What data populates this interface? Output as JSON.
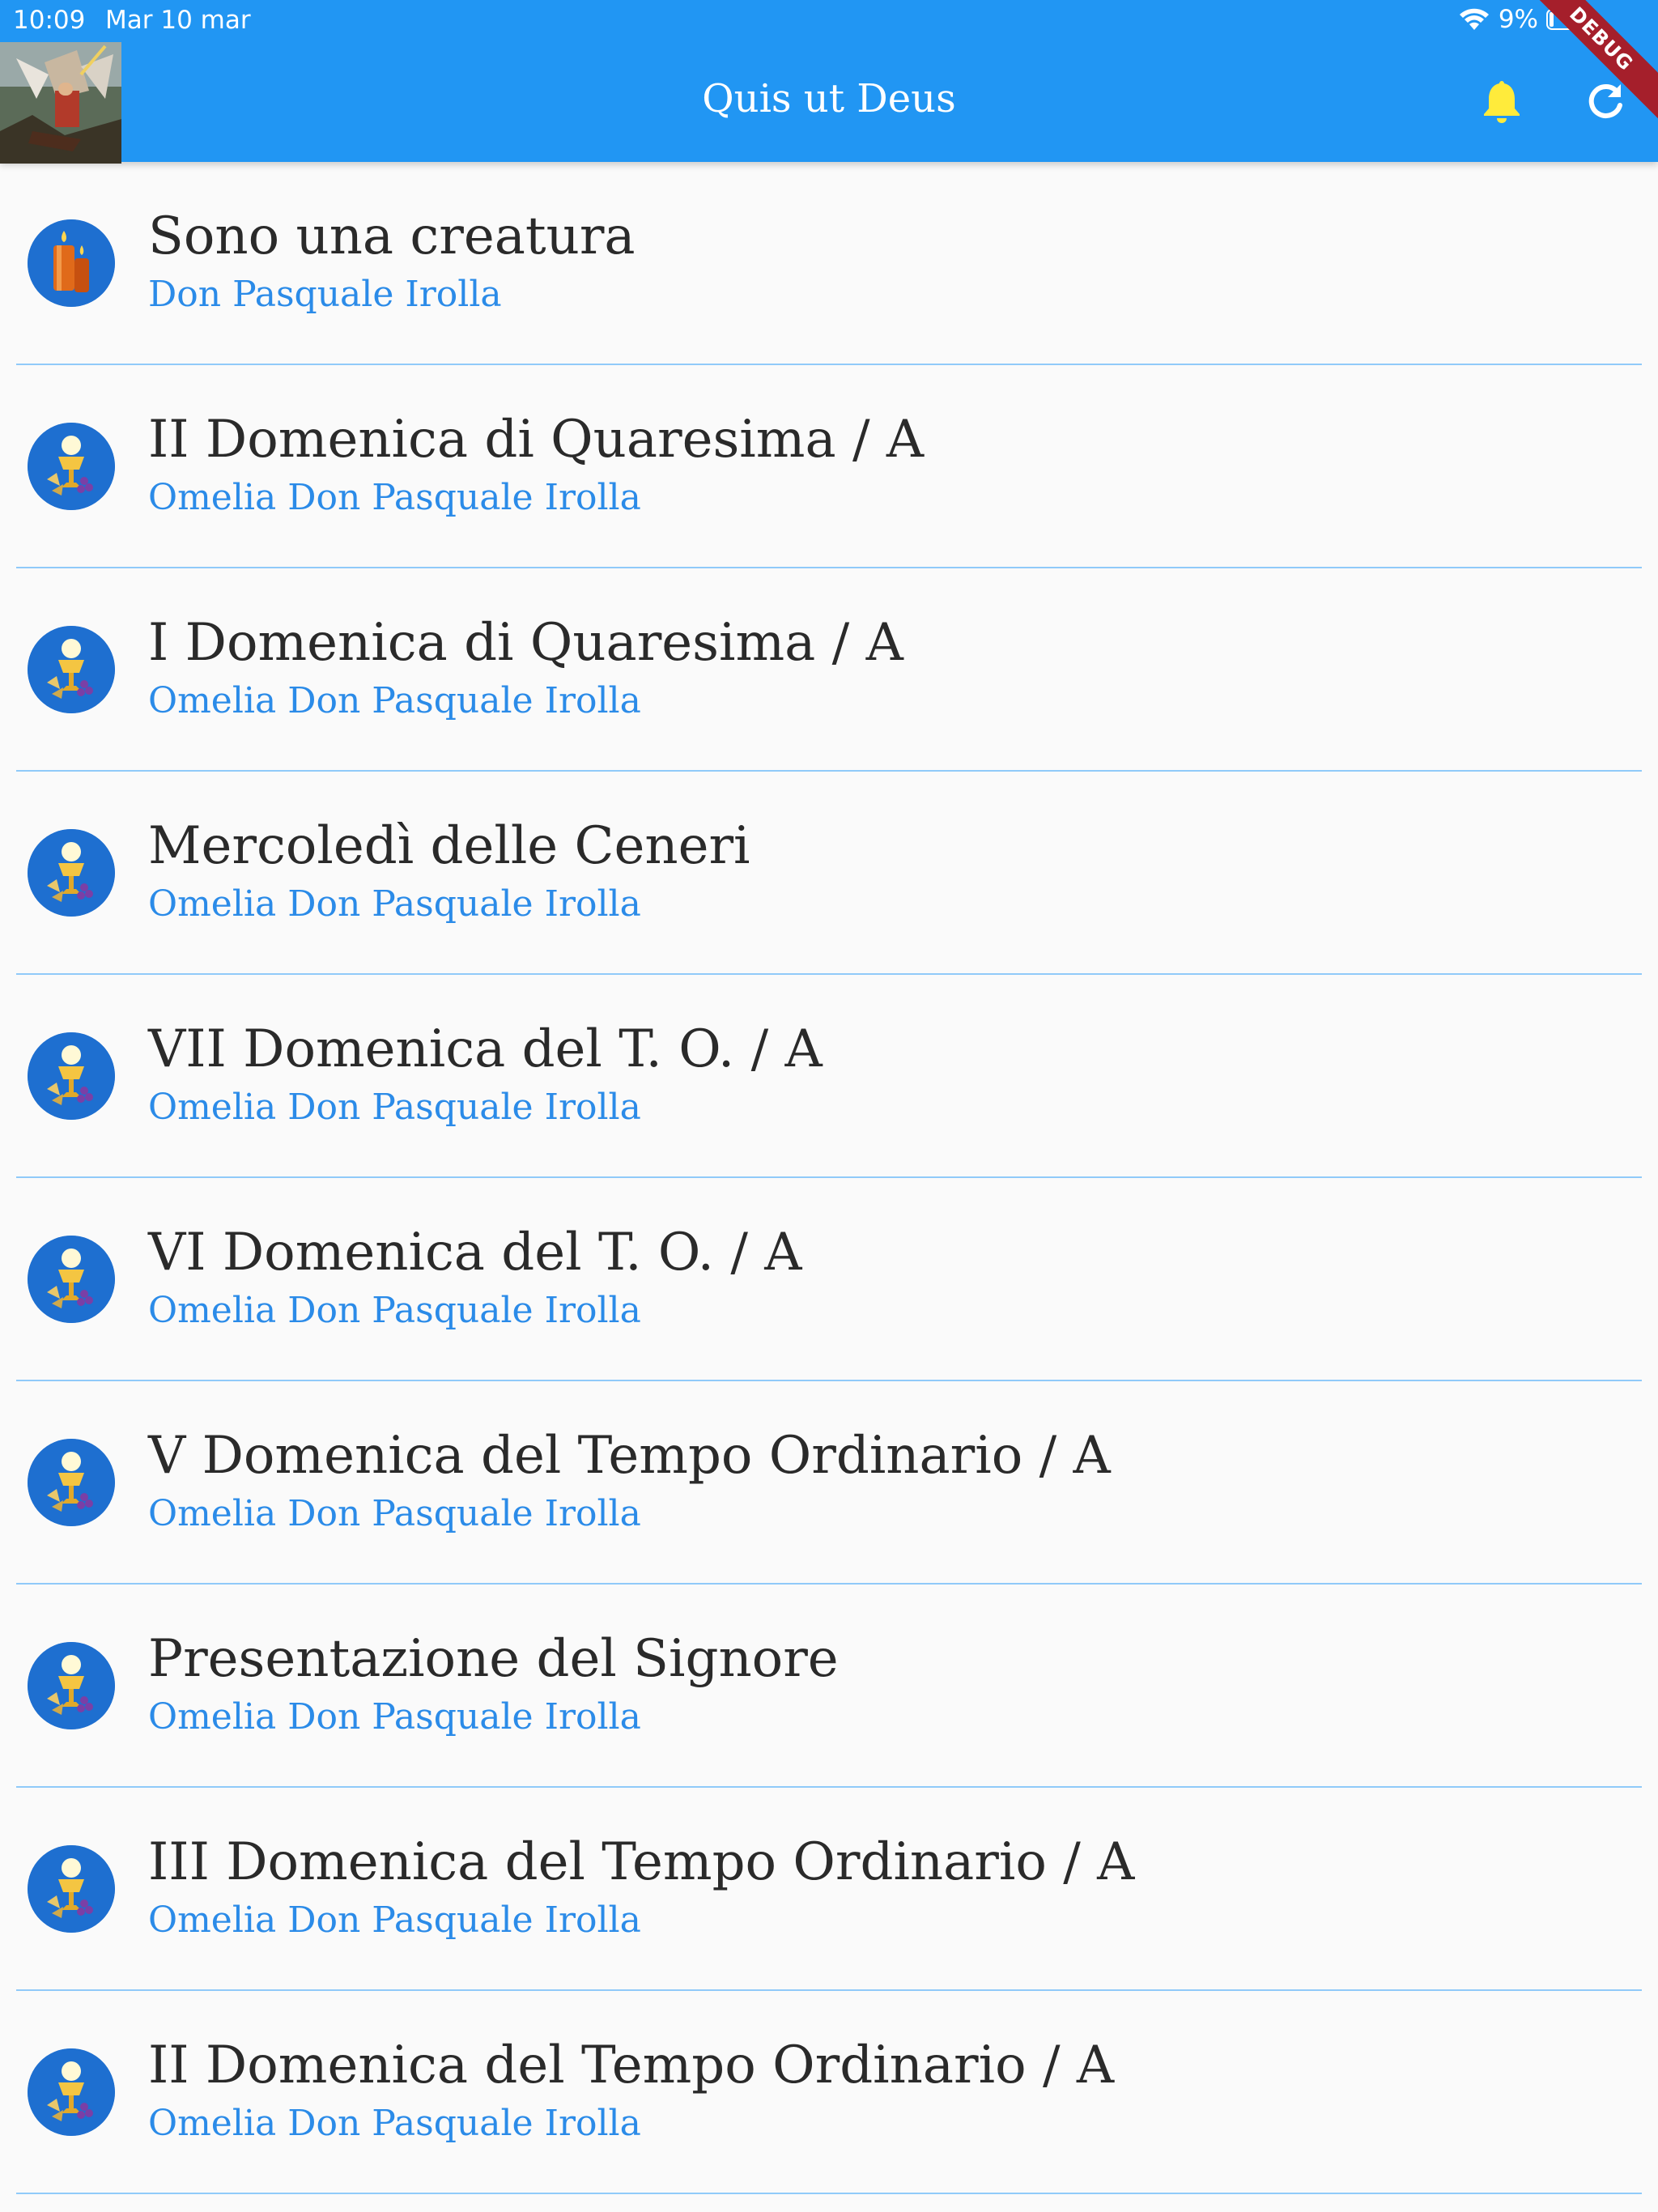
{
  "status_bar": {
    "time": "10:09",
    "date": "Mar 10 mar",
    "battery": "9%"
  },
  "app_bar": {
    "title": "Quis ut Deus",
    "debug_label": "DEBUG",
    "color": "#2196f3",
    "bell_icon_color": "#ffeb3b",
    "icons": [
      "archangel-image",
      "bell-icon",
      "refresh-icon"
    ]
  },
  "list": {
    "title_color": "#2a2a2a",
    "subtitle_color": "#2b8be8",
    "divider_color": "#90caf9",
    "items": [
      {
        "title": "Sono una creatura",
        "subtitle": "Don Pasquale Irolla",
        "icon": "candles-icon"
      },
      {
        "title": "II Domenica di Quaresima / A",
        "subtitle": "Omelia Don Pasquale Irolla",
        "icon": "chalice-icon"
      },
      {
        "title": "I Domenica di Quaresima / A",
        "subtitle": "Omelia Don Pasquale Irolla",
        "icon": "chalice-icon"
      },
      {
        "title": "Mercoledì delle Ceneri",
        "subtitle": "Omelia Don Pasquale Irolla",
        "icon": "chalice-icon"
      },
      {
        "title": "VII Domenica del T. O. / A",
        "subtitle": "Omelia Don Pasquale Irolla",
        "icon": "chalice-icon"
      },
      {
        "title": "VI Domenica del T. O. / A",
        "subtitle": "Omelia Don Pasquale Irolla",
        "icon": "chalice-icon"
      },
      {
        "title": "V Domenica del Tempo Ordinario / A",
        "subtitle": "Omelia Don Pasquale Irolla",
        "icon": "chalice-icon"
      },
      {
        "title": "Presentazione del Signore",
        "subtitle": "Omelia Don Pasquale Irolla",
        "icon": "chalice-icon"
      },
      {
        "title": "III Domenica del Tempo Ordinario / A",
        "subtitle": "Omelia Don Pasquale Irolla",
        "icon": "chalice-icon"
      },
      {
        "title": "II Domenica del Tempo Ordinario / A",
        "subtitle": "Omelia Don Pasquale Irolla",
        "icon": "chalice-icon"
      }
    ]
  }
}
